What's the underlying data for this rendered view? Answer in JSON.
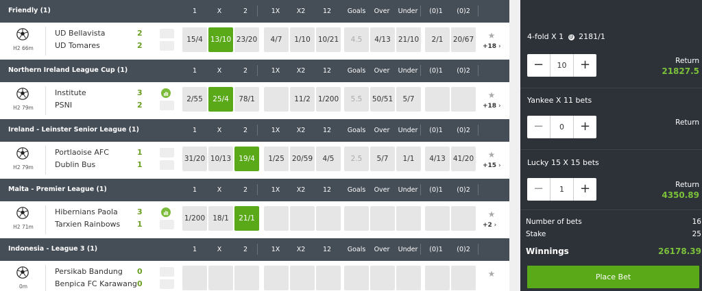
{
  "columns": [
    "1",
    "X",
    "2",
    "1X",
    "X2",
    "12",
    "Goals",
    "Over",
    "Under",
    "(0)1",
    "(0)2"
  ],
  "leagues": [
    {
      "name": "Friendly (1)",
      "match": {
        "home": "UD Bellavista",
        "away": "UD Tomares",
        "home_score": "2",
        "away_score": "2",
        "time": "H2 66m",
        "odds": [
          "15/4",
          "13/10",
          "23/20",
          "4/7",
          "1/10",
          "10/21",
          "4.5",
          "4/13",
          "21/10",
          "2/1",
          "20/67"
        ],
        "more": "+18"
      }
    },
    {
      "name": "Northern Ireland League Cup (1)",
      "match": {
        "home": "Institute",
        "away": "PSNI",
        "home_score": "3",
        "away_score": "2",
        "time": "H2 79m",
        "odds": [
          "2/55",
          "25/4",
          "78/1",
          "",
          "11/2",
          "1/200",
          "5.5",
          "50/51",
          "5/7",
          "",
          ""
        ],
        "more": "+18"
      }
    },
    {
      "name": "Ireland - Leinster Senior League (1)",
      "match": {
        "home": "Portlaoise AFC",
        "away": "Dublin Bus",
        "home_score": "1",
        "away_score": "1",
        "time": "H2 79m",
        "odds": [
          "31/20",
          "10/13",
          "19/4",
          "1/25",
          "20/59",
          "4/5",
          "2.5",
          "5/7",
          "1/1",
          "4/13",
          "41/20"
        ],
        "more": "+15"
      }
    },
    {
      "name": "Malta - Premier League (1)",
      "match": {
        "home": "Hibernians Paola",
        "away": "Tarxien Rainbows",
        "home_score": "3",
        "away_score": "1",
        "time": "H2 71m",
        "odds": [
          "1/200",
          "18/1",
          "21/1",
          "",
          "",
          "",
          "",
          "",
          "",
          "",
          ""
        ],
        "more": "+2"
      }
    },
    {
      "name": "Indonesia - League 3 (1)",
      "match": {
        "home": "Persikab Bandung",
        "away": "Benpica FC Karawang",
        "home_score": "0",
        "away_score": "0",
        "time": "0m",
        "odds": [
          "",
          "",
          "",
          "",
          "",
          "",
          "",
          "",
          "",
          "",
          ""
        ],
        "more": ""
      }
    }
  ],
  "betslip": {
    "fourfold": {
      "title": "4-fold X  1",
      "odds": "2181/1",
      "stake": "10",
      "return_label": "Return",
      "return_value": "21827.5"
    },
    "yankee": {
      "title": "Yankee X  11 bets",
      "stake": "0",
      "return_label": "Return"
    },
    "lucky15": {
      "title": "Lucky 15 X  15 bets",
      "stake": "1",
      "return_label": "Return",
      "return_value": "4350.89"
    },
    "number_of_bets_label": "Number of bets",
    "number_of_bets": "16",
    "stake_label": "Stake",
    "stake_total": "25",
    "winnings_label": "Winnings",
    "winnings": "26178.39",
    "place_bet": "Place Bet",
    "minus": "−",
    "plus": "+"
  },
  "colors": {
    "accent": "#59a918",
    "header": "#454d57",
    "slip_bg": "#2d3239",
    "score": "#6a9f22"
  }
}
